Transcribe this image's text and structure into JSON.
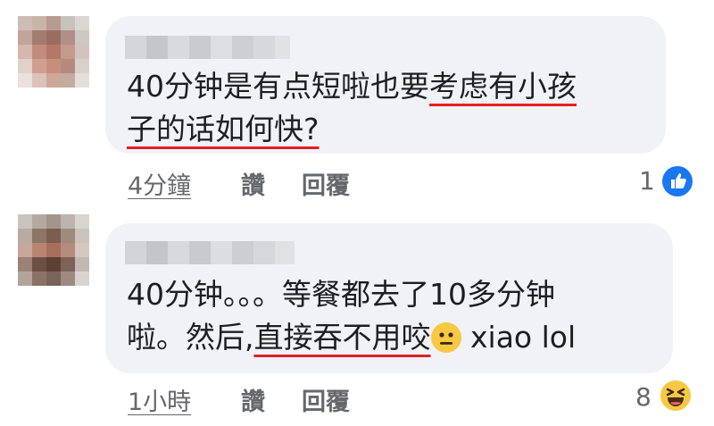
{
  "comments": [
    {
      "text_line1_plain": "40分钟是有点短啦也要",
      "text_line1_underlined": "考虑有小孩",
      "text_line2_underlined": "子的话如何快?",
      "time": "4分鐘",
      "like_label": "讚",
      "reply_label": "回覆",
      "reaction_count": "1",
      "reaction_icon": "like-thumb-icon",
      "accent": "#1877f2"
    },
    {
      "text_line1": "40分钟。。。等餐都去了10多分钟",
      "text_line2_plain_start": "啦。然后,",
      "text_line2_underlined": "直接吞不用咬",
      "text_line2_emoji": "neutral-face-icon",
      "text_line2_plain_end": " xiao lol",
      "time": "1小時",
      "like_label": "讚",
      "reply_label": "回覆",
      "reaction_count": "8",
      "reaction_icon": "haha-laugh-icon",
      "accent": "#f7c843"
    }
  ]
}
